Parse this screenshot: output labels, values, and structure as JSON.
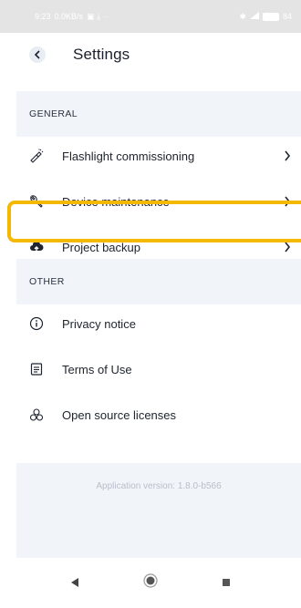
{
  "status_bar": {
    "time": "9:23",
    "net_speed": "0.0KB/s",
    "battery": "84"
  },
  "header": {
    "title": "Settings"
  },
  "general": {
    "heading": "GENERAL",
    "items": [
      {
        "label": "Flashlight commissioning",
        "icon": "flashlight-icon"
      },
      {
        "label": "Device maintenance",
        "icon": "wrench-icon"
      },
      {
        "label": "Project backup",
        "icon": "cloud-upload-icon"
      }
    ]
  },
  "other": {
    "heading": "OTHER",
    "items": [
      {
        "label": "Privacy notice",
        "icon": "info-icon"
      },
      {
        "label": "Terms of Use",
        "icon": "document-icon"
      },
      {
        "label": "Open source licenses",
        "icon": "license-icon"
      }
    ]
  },
  "footer": {
    "version": "Application version: 1.8.0-b566"
  },
  "colors": {
    "highlight": "#f5b800",
    "band": "#f1f4f8"
  }
}
